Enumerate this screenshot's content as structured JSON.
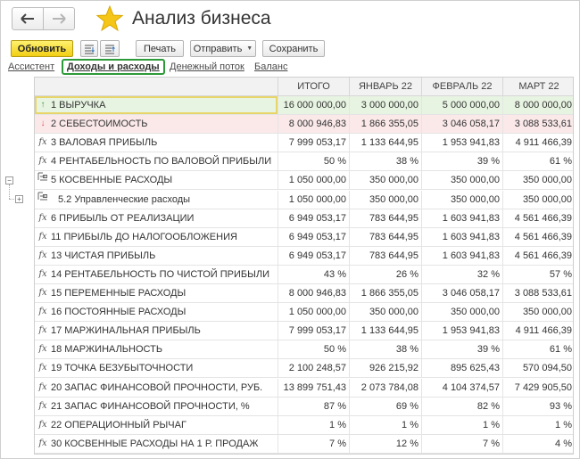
{
  "header": {
    "title": "Анализ бизнеса"
  },
  "toolbar": {
    "refresh": "Обновить",
    "print": "Печать",
    "send": "Отправить",
    "save": "Сохранить"
  },
  "tabs": [
    "Ассистент",
    "Доходы и расходы",
    "Денежный поток",
    "Баланс"
  ],
  "table": {
    "columns": [
      "ИТОГО",
      "ЯНВАРЬ 22",
      "ФЕВРАЛЬ 22",
      "МАРТ 22"
    ],
    "rows": [
      {
        "icon": "up-arrow-icon",
        "label": "1  ВЫРУЧКА",
        "values": [
          "16 000 000,00",
          "3 000 000,00",
          "5 000 000,00",
          "8 000 000,00"
        ]
      },
      {
        "icon": "down-arrow-icon",
        "label": "2  СЕБЕСТОИМОСТЬ",
        "values": [
          "8 000 946,83",
          "1 866 355,05",
          "3 046 058,17",
          "3 088 533,61"
        ]
      },
      {
        "icon": "fx-icon",
        "label": "3  ВАЛОВАЯ ПРИБЫЛЬ",
        "values": [
          "7 999 053,17",
          "1 133 644,95",
          "1 953 941,83",
          "4 911 466,39"
        ]
      },
      {
        "icon": "fx-icon",
        "label": "4  РЕНТАБЕЛЬНОСТЬ ПО ВАЛОВОЙ ПРИБЫЛИ",
        "values": [
          "50 %",
          "38 %",
          "39 %",
          "61 %"
        ]
      },
      {
        "icon": "group-icon",
        "label": "5  КОСВЕННЫЕ РАСХОДЫ",
        "values": [
          "1 050 000,00",
          "350 000,00",
          "350 000,00",
          "350 000,00"
        ]
      },
      {
        "icon": "group-icon",
        "label": "5.2  Управленческие расходы",
        "values": [
          "1 050 000,00",
          "350 000,00",
          "350 000,00",
          "350 000,00"
        ]
      },
      {
        "icon": "fx-icon",
        "label": "6  ПРИБЫЛЬ ОТ РЕАЛИЗАЦИИ",
        "values": [
          "6 949 053,17",
          "783 644,95",
          "1 603 941,83",
          "4 561 466,39"
        ]
      },
      {
        "icon": "fx-icon",
        "label": "11  ПРИБЫЛЬ ДО НАЛОГООБЛОЖЕНИЯ",
        "values": [
          "6 949 053,17",
          "783 644,95",
          "1 603 941,83",
          "4 561 466,39"
        ]
      },
      {
        "icon": "fx-icon",
        "label": "13  ЧИСТАЯ ПРИБЫЛЬ",
        "values": [
          "6 949 053,17",
          "783 644,95",
          "1 603 941,83",
          "4 561 466,39"
        ]
      },
      {
        "icon": "fx-icon",
        "label": "14  РЕНТАБЕЛЬНОСТЬ ПО ЧИСТОЙ ПРИБЫЛИ",
        "values": [
          "43 %",
          "26 %",
          "32 %",
          "57 %"
        ]
      },
      {
        "icon": "fx-icon",
        "label": "15  ПЕРЕМЕННЫЕ РАСХОДЫ",
        "values": [
          "8 000 946,83",
          "1 866 355,05",
          "3 046 058,17",
          "3 088 533,61"
        ]
      },
      {
        "icon": "fx-icon",
        "label": "16  ПОСТОЯННЫЕ РАСХОДЫ",
        "values": [
          "1 050 000,00",
          "350 000,00",
          "350 000,00",
          "350 000,00"
        ]
      },
      {
        "icon": "fx-icon",
        "label": "17  МАРЖИНАЛЬНАЯ ПРИБЫЛЬ",
        "values": [
          "7 999 053,17",
          "1 133 644,95",
          "1 953 941,83",
          "4 911 466,39"
        ]
      },
      {
        "icon": "fx-icon",
        "label": "18  МАРЖИНАЛЬНОСТЬ",
        "values": [
          "50 %",
          "38 %",
          "39 %",
          "61 %"
        ]
      },
      {
        "icon": "fx-icon",
        "label": "19  ТОЧКА БЕЗУБЫТОЧНОСТИ",
        "values": [
          "2 100 248,57",
          "926 215,92",
          "895 625,43",
          "570 094,50"
        ]
      },
      {
        "icon": "fx-icon",
        "label": "20  ЗАПАС ФИНАНСОВОЙ ПРОЧНОСТИ, РУБ.",
        "values": [
          "13 899 751,43",
          "2 073 784,08",
          "4 104 374,57",
          "7 429 905,50"
        ]
      },
      {
        "icon": "fx-icon",
        "label": "21  ЗАПАС ФИНАНСОВОЙ ПРОЧНОСТИ, %",
        "values": [
          "87 %",
          "69 %",
          "82 %",
          "93 %"
        ]
      },
      {
        "icon": "fx-icon",
        "label": "22  ОПЕРАЦИОННЫЙ РЫЧАГ",
        "values": [
          "1 %",
          "1 %",
          "1 %",
          "1 %"
        ]
      },
      {
        "icon": "fx-icon",
        "label": "30  КОСВЕННЫЕ РАСХОДЫ НА 1 Р. ПРОДАЖ",
        "values": [
          "7 %",
          "12 %",
          "7 %",
          "4 %"
        ]
      }
    ]
  },
  "colors": {
    "accent_green": "#2d9a3a",
    "primary_button": "#f2cf13",
    "row_highlight_green": "#e8f4e2",
    "row_highlight_red": "#fbe9ea"
  }
}
